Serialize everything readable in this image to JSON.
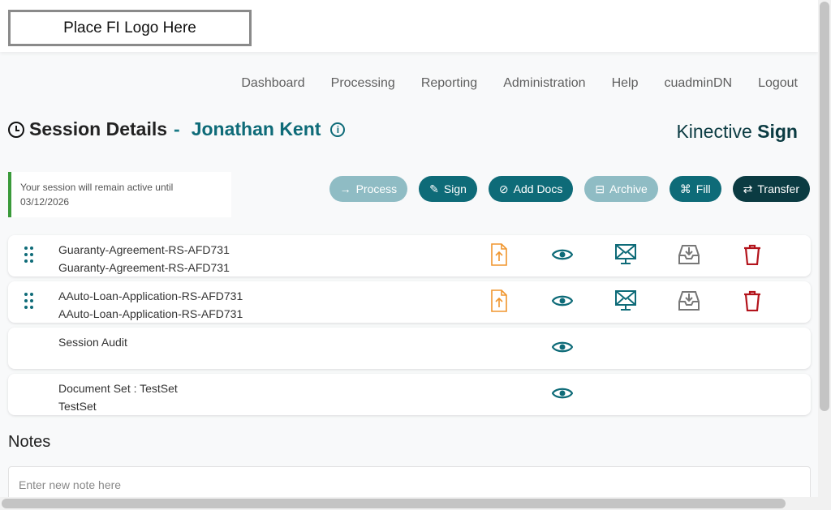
{
  "header": {
    "logo_text": "Place FI Logo Here"
  },
  "nav": [
    "Dashboard",
    "Processing",
    "Reporting",
    "Administration",
    "Help",
    "cuadminDN",
    "Logout"
  ],
  "page": {
    "title": "Session Details",
    "separator": "-",
    "customer": "Jonathan Kent",
    "brand_regular": "Kinective ",
    "brand_bold": "Sign"
  },
  "session": {
    "line1": "Your session will remain active until",
    "line2": "03/12/2026"
  },
  "actions": [
    {
      "label": "Process",
      "icon": "arrow-right-icon",
      "state": "disabled"
    },
    {
      "label": "Sign",
      "icon": "pen-icon",
      "state": "active"
    },
    {
      "label": "Add Docs",
      "icon": "paperclip-icon",
      "state": "active"
    },
    {
      "label": "Archive",
      "icon": "archive-icon",
      "state": "disabled"
    },
    {
      "label": "Fill",
      "icon": "fill-icon",
      "state": "active"
    },
    {
      "label": "Transfer",
      "icon": "transfer-icon",
      "state": "primary"
    }
  ],
  "documents": [
    {
      "line1": "Guaranty-Agreement-RS-AFD731",
      "line2": "Guaranty-Agreement-RS-AFD731"
    },
    {
      "line1": "AAuto-Loan-Application-RS-AFD731",
      "line2": "AAuto-Loan-Application-RS-AFD731"
    },
    {
      "line1": "Session Audit",
      "line2": ""
    },
    {
      "line1": "Document Set : TestSet",
      "line2": "TestSet"
    }
  ],
  "notes": {
    "label": "Notes",
    "placeholder": "Enter new note here"
  },
  "colors": {
    "accent": "#0e6b78",
    "dark": "#0b3b42",
    "upload": "#f0962e",
    "delete": "#b3141c",
    "archive_icon": "#777777",
    "status_bar": "#3a9a3a"
  }
}
